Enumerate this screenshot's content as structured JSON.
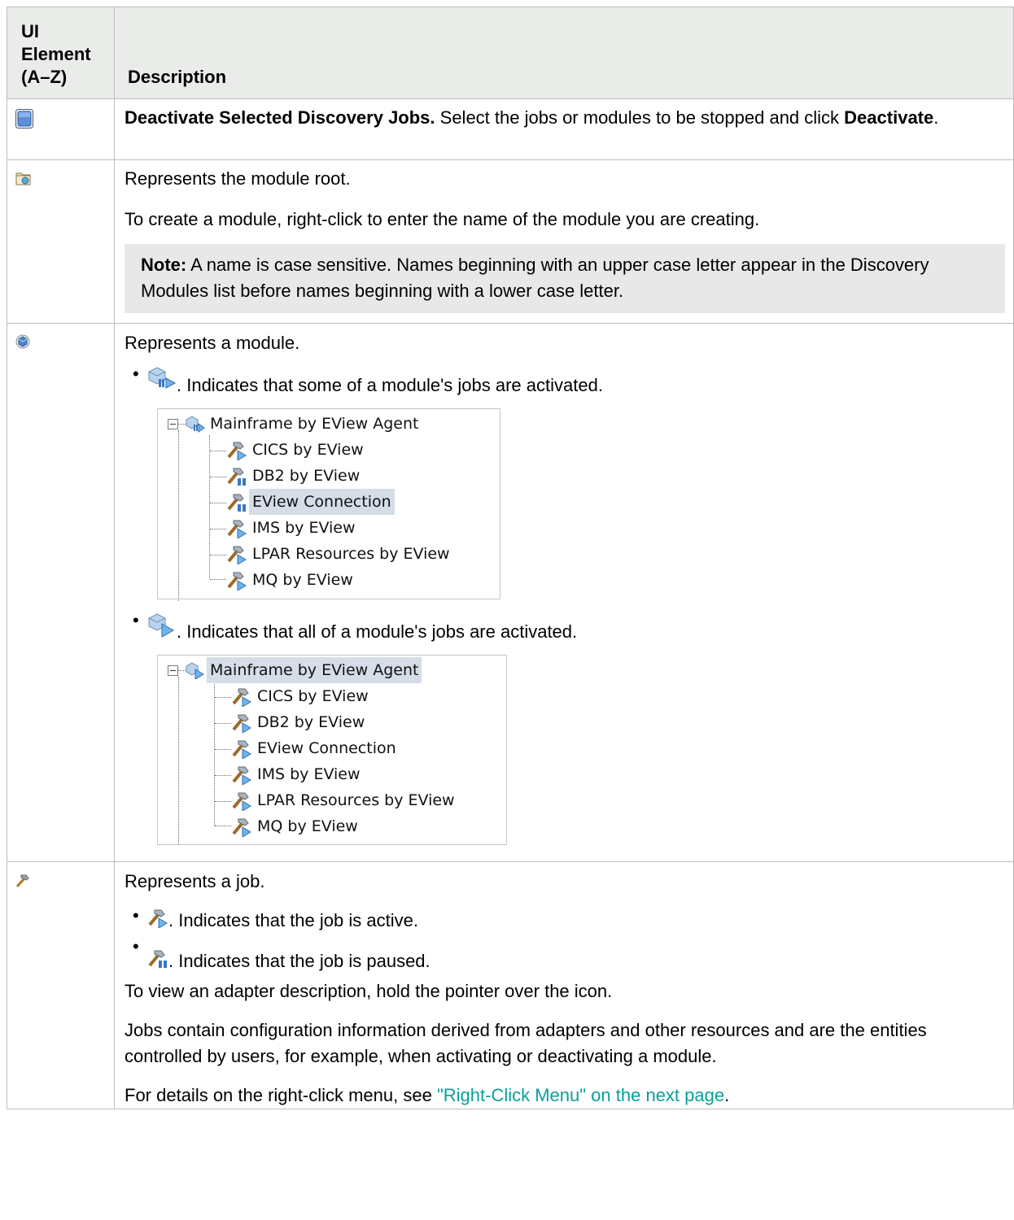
{
  "table": {
    "header": {
      "col1": "UI Element (A–Z)",
      "col2": "Description"
    },
    "rows": {
      "deactivate": {
        "icon": "deactivate-square-icon",
        "title": "Deactivate Selected Discovery Jobs.",
        "text1": " Select the jobs or modules to be stopped and click ",
        "bold2": "Deactivate",
        "text2": "."
      },
      "module_root": {
        "icon": "module-root-folder-icon",
        "p1": "Represents the module root.",
        "p2": "To create a module, right-click to enter the name of the module you are creating.",
        "note_label": "Note:",
        "note_text": " A name is case sensitive. Names beginning with an upper case letter appear in the Discovery Modules list before names beginning with a lower case letter."
      },
      "module": {
        "icon": "module-cube-icon",
        "p1": "Represents a module.",
        "bullet1": ". Indicates that some of a module's jobs are activated.",
        "bullet2": ". Indicates that all of a module's jobs are activated.",
        "tree1": {
          "root": "Mainframe by EView Agent",
          "items": [
            "CICS by EView",
            "DB2 by EView",
            "EView Connection",
            "IMS by EView",
            "LPAR Resources by EView",
            "MQ by EView"
          ]
        },
        "tree2": {
          "root": "Mainframe by EView Agent",
          "items": [
            "CICS by EView",
            "DB2 by EView",
            "EView Connection",
            "IMS by EView",
            "LPAR Resources by EView",
            "MQ by EView"
          ]
        }
      },
      "job": {
        "icon": "job-hammer-icon",
        "p1": "Represents a job.",
        "bullet1": ". Indicates that the job is active.",
        "bullet2": ". Indicates that the job is paused.",
        "p2": "To view an adapter description, hold the pointer over the icon.",
        "p3": "Jobs contain configuration information derived from adapters and other resources and are the entities controlled by users, for example, when activating or deactivating a module.",
        "p4_prefix": "For details on the right-click menu, see ",
        "p4_link": "\"Right-Click Menu\" on the next page",
        "p4_suffix": "."
      }
    }
  }
}
